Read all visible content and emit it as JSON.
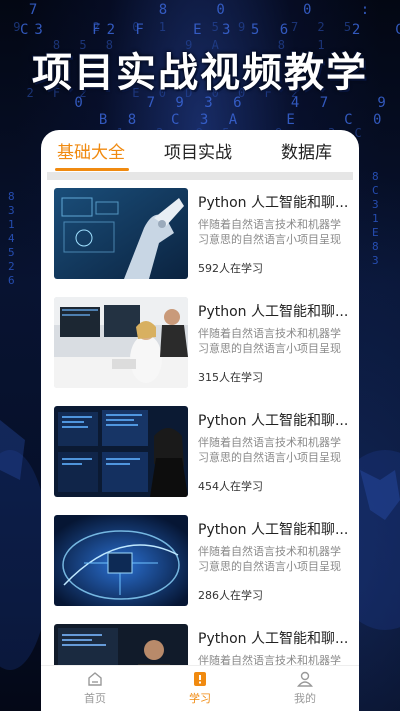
{
  "headline": "项目实战视频教学",
  "background_code": {
    "lines": [
      "  7        8   0     0   :",
      " 9     2  0 1   5 9   7 2 5",
      "C3   F2 F   E 3 5 6    2  C",
      "    8 5 8     9 A    8  1",
      "  2 F 2   E 0 D 0 0 F 2",
      " 0    7 9 3 6   4 7   9   A",
      "  B 8  C 3 A   E   C 0 A D 1 B F 2",
      "  1  2  9 5   9   3 C"
    ],
    "left_column": "8\n3\n1\n4\n5\n2\n6",
    "right_column": "8\nC\n3\n1\nE\n8\n3"
  },
  "tabs": [
    {
      "label": "基础大全",
      "active": true
    },
    {
      "label": "项目实战",
      "active": false
    },
    {
      "label": "数据库",
      "active": false
    }
  ],
  "courses": [
    {
      "title": "Python 人工智能和聊...",
      "description": "伴随着自然语言技术和机器学习意思的自然语言小项目呈现在大",
      "count": "592人在学习",
      "thumb": "robot-hand"
    },
    {
      "title": "Python 人工智能和聊...",
      "description": "伴随着自然语言技术和机器学习意思的自然语言小项目呈现在大",
      "count": "315人在学习",
      "thumb": "office-team"
    },
    {
      "title": "Python 人工智能和聊...",
      "description": "伴随着自然语言技术和机器学习意思的自然语言小项目呈现在大",
      "count": "454人在学习",
      "thumb": "monitors-woman"
    },
    {
      "title": "Python 人工智能和聊...",
      "description": "伴随着自然语言技术和机器学习意思的自然语言小项目呈现在大",
      "count": "286人在学习",
      "thumb": "circuit-chip"
    },
    {
      "title": "Python 人工智能和聊...",
      "description": "伴随着自然语言技术和机器学习意思的自然语言小项目呈现在大",
      "count": "",
      "thumb": "developer-screens"
    }
  ],
  "bottom_nav": [
    {
      "label": "首页",
      "icon": "home-icon",
      "active": false
    },
    {
      "label": "学习",
      "icon": "book-icon",
      "active": true
    },
    {
      "label": "我的",
      "icon": "user-icon",
      "active": false
    }
  ],
  "colors": {
    "accent": "#f08a10",
    "background": "#050a1c",
    "code": "#3a66d8"
  }
}
